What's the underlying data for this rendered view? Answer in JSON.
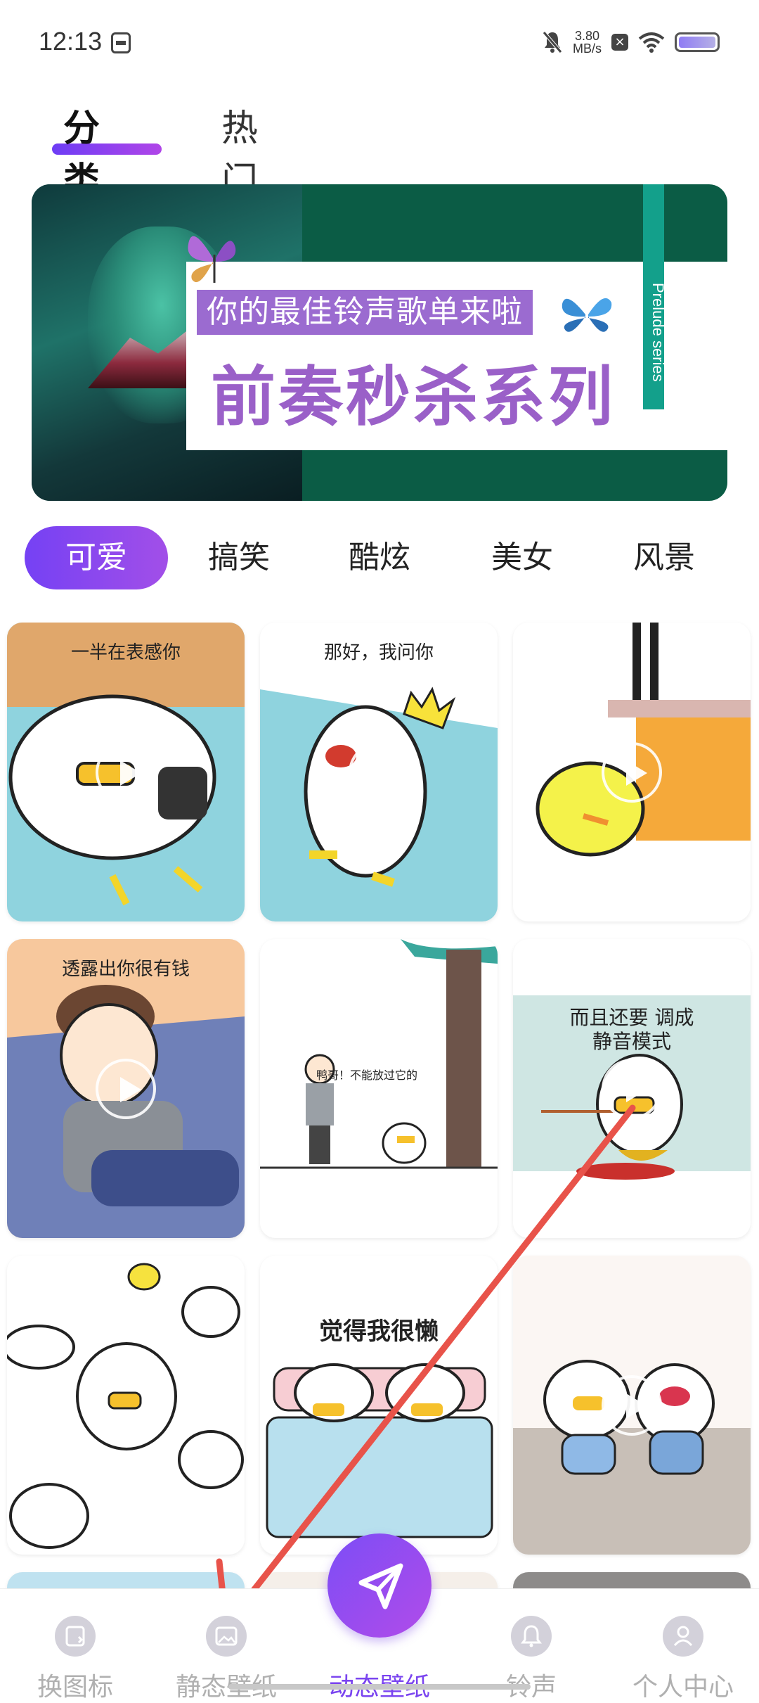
{
  "status": {
    "time": "12:13",
    "speed_value": "3.80",
    "speed_unit": "MB/s"
  },
  "top_tabs": [
    {
      "label": "分类",
      "active": true
    },
    {
      "label": "热门",
      "active": false
    }
  ],
  "banner": {
    "line1": "你的最佳铃声歌单来啦",
    "line2": "前奏秒杀系列",
    "side_text": "Prelude series"
  },
  "categories": [
    "可爱",
    "搞笑",
    "酷炫",
    "美女",
    "风景"
  ],
  "cards": [
    {
      "caption": "一半在表感你"
    },
    {
      "caption": "那好，我问你"
    },
    {
      "caption": ""
    },
    {
      "caption": "透露出你很有钱"
    },
    {
      "caption": "鸭哥！不能放过它的"
    },
    {
      "caption": "而且还要 调成静音模式"
    },
    {
      "caption": ""
    },
    {
      "caption": "觉得我很懒"
    },
    {
      "caption": ""
    }
  ],
  "bottom_nav": [
    {
      "label": "换图标",
      "icon": "swap-icon"
    },
    {
      "label": "静态壁纸",
      "icon": "image-icon"
    },
    {
      "label": "动态壁纸",
      "icon": "send-icon",
      "active": true
    },
    {
      "label": "铃声",
      "icon": "bell-icon"
    },
    {
      "label": "个人中心",
      "icon": "person-icon"
    }
  ],
  "colors": {
    "accent": "#7a44ef",
    "banner_green": "#0b5c45",
    "arrow": "#e8534a"
  }
}
